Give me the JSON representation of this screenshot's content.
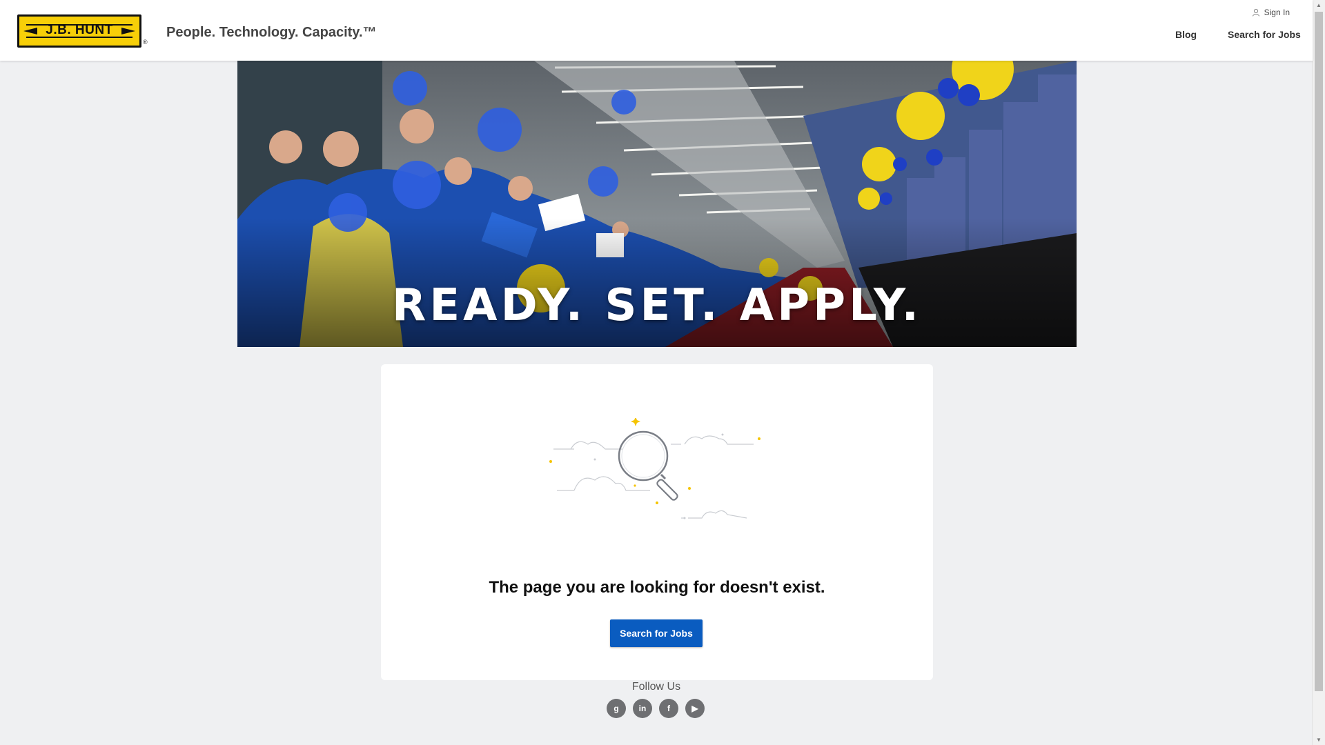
{
  "header": {
    "logo_text": "J.B. HUNT",
    "logo_reg": "®",
    "tagline": "People. Technology. Capacity.™",
    "sign_in": "Sign In",
    "nav": [
      {
        "label": "Blog"
      },
      {
        "label": "Search for Jobs"
      }
    ]
  },
  "hero": {
    "headline": "READY. SET. APPLY."
  },
  "card": {
    "message": "The page you are looking for doesn't exist.",
    "button_label": "Search for Jobs"
  },
  "footer": {
    "follow_label": "Follow Us",
    "socials": [
      {
        "name": "glassdoor",
        "glyph": "g"
      },
      {
        "name": "linkedin",
        "glyph": "in"
      },
      {
        "name": "facebook",
        "glyph": "f"
      },
      {
        "name": "youtube",
        "glyph": "▶"
      }
    ]
  },
  "colors": {
    "brand_yellow": "#f7cf08",
    "button_blue": "#0a5cc0",
    "page_bg": "#eff0f2"
  }
}
